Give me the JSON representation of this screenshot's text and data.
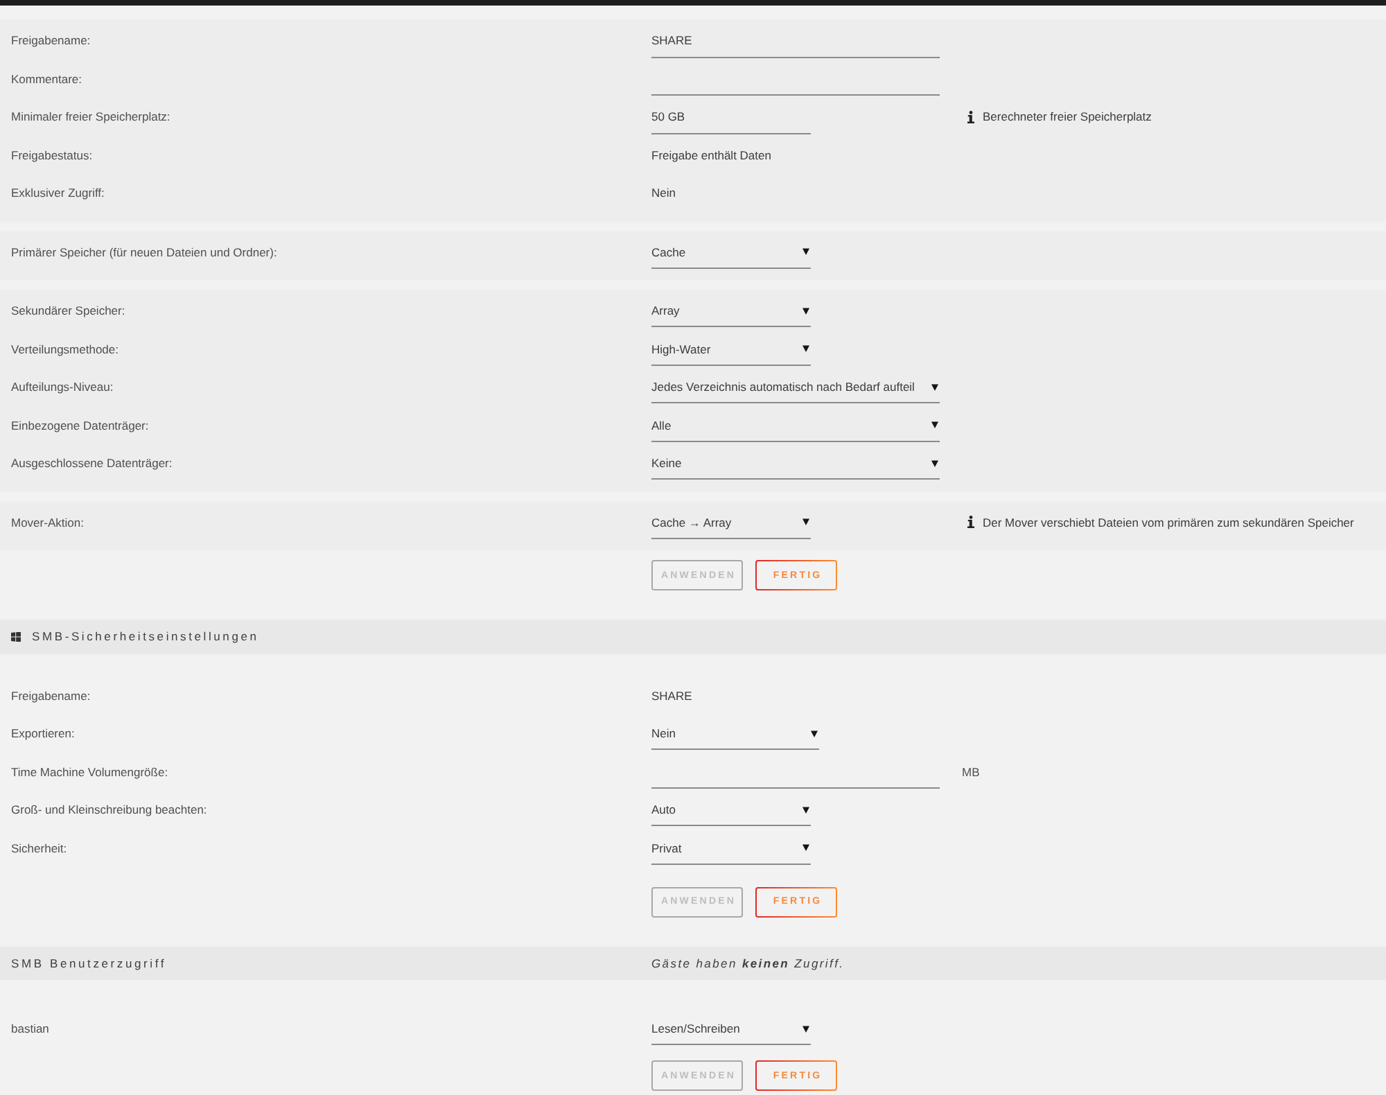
{
  "sections": [
    {
      "kind": "grouped",
      "groups": [
        {
          "rows": [
            {
              "label": "Freigabename:",
              "kind": "text_input",
              "value": "SHARE"
            },
            {
              "label": "Kommentare:",
              "kind": "text_input"
            },
            {
              "label": "Minimaler freier Speicherplatz:",
              "kind": "text_input",
              "value": "50 GB",
              "info": "Berechneter freier Speicherplatz"
            },
            {
              "label": "Freigabestatus:",
              "kind": "static",
              "value": "Freigabe enthält Daten"
            },
            {
              "label": "Exklusiver Zugriff:",
              "kind": "static",
              "value": "Nein"
            }
          ]
        },
        {
          "rows": [
            {
              "label": "Primärer Speicher (für neuen Dateien und Ordner):",
              "kind": "select",
              "value": "Cache"
            }
          ]
        },
        {
          "rows": [
            {
              "label": "Sekundärer Speicher:",
              "kind": "select",
              "value": "Array"
            },
            {
              "label": "Verteilungsmethode:",
              "kind": "select",
              "value": "High-Water"
            },
            {
              "label": "Aufteilungs-Niveau:",
              "kind": "select",
              "value": "Jedes Verzeichnis automatisch nach Bedarf aufteil"
            },
            {
              "label": "Einbezogene Datenträger:",
              "kind": "select",
              "value": "Alle"
            },
            {
              "label": "Ausgeschlossene Datenträger:",
              "kind": "select",
              "value": "Keine"
            }
          ]
        },
        {
          "rows": [
            {
              "label": "Mover-Aktion:",
              "kind": "select",
              "value": "Cache → Array",
              "info": "Der Mover verschiebt Dateien vom primären zum sekundären Speicher"
            }
          ]
        }
      ],
      "buttons": [
        {
          "label": "ANWENDEN",
          "disabled": true
        },
        {
          "label": "FERTIG",
          "disabled": false
        }
      ]
    },
    {
      "kind": "titled",
      "title": "SMB-Sicherheitseinstellungen",
      "rows": [
        {
          "label": "Freigabename:",
          "kind": "static",
          "value": "SHARE"
        },
        {
          "label": "Exportieren:",
          "kind": "select",
          "value": "Nein"
        },
        {
          "label": "Time Machine Volumengröße:",
          "kind": "text_input",
          "unit": "MB"
        },
        {
          "label": "Groß- und Kleinschreibung beachten:",
          "kind": "select",
          "value": "Auto"
        },
        {
          "label": "Sicherheit:",
          "kind": "select",
          "value": "Privat"
        }
      ],
      "buttons": [
        {
          "label": "ANWENDEN",
          "disabled": true
        },
        {
          "label": "FERTIG",
          "disabled": false
        }
      ]
    },
    {
      "kind": "titled",
      "title": "SMB Benutzerzugriff",
      "note": "Gäste haben **keinen** Zugriff.",
      "rows": [
        {
          "label": "bastian",
          "kind": "select",
          "value": "Lesen/Schreiben"
        }
      ],
      "buttons": [
        {
          "label": "ANWENDEN",
          "disabled": true
        },
        {
          "label": "FERTIG",
          "disabled": false
        }
      ]
    }
  ]
}
